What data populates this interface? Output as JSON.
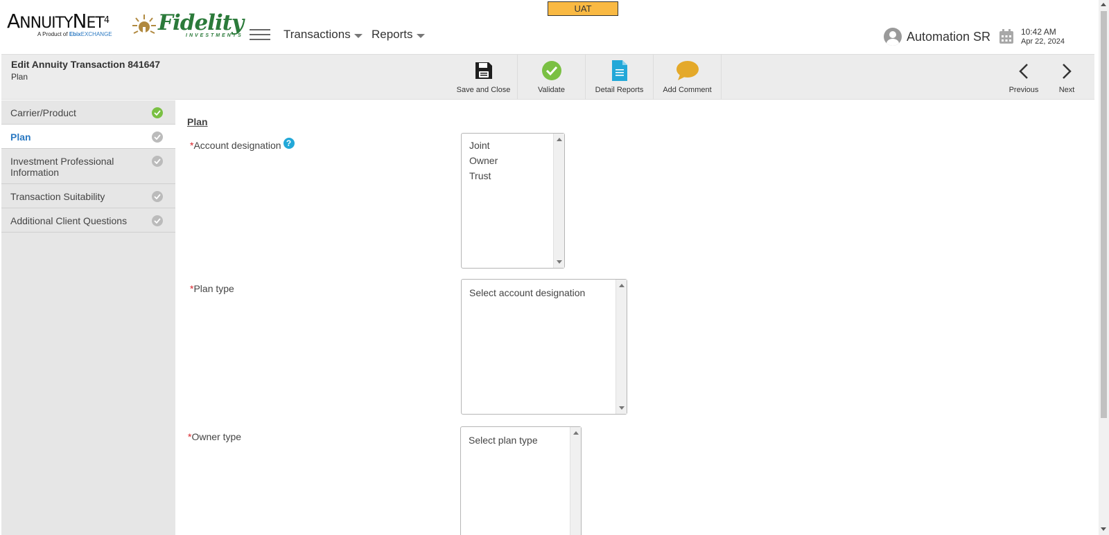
{
  "header": {
    "env_badge": "UAT",
    "logo_brand_big": "A",
    "logo_brand_rest": "NNUITY",
    "logo_brand_net": "N",
    "logo_brand_et": "ET",
    "logo_version": "4",
    "logo_sub_prefix": "A Product of",
    "logo_sub_ebix": "Ebix",
    "logo_sub_exchange": "EXCHANGE",
    "partner_name": "Fidelity",
    "partner_sub": "INVESTMENTS",
    "nav": [
      {
        "label": "Transactions"
      },
      {
        "label": "Reports"
      }
    ],
    "user_name": "Automation SR",
    "time": "10:42 AM",
    "date": "Apr 22, 2024"
  },
  "toolbar": {
    "title": "Edit Annuity Transaction 841647",
    "subtitle": "Plan",
    "buttons": [
      {
        "label": "Save and Close",
        "icon": "save-icon"
      },
      {
        "label": "Validate",
        "icon": "check-circle-icon",
        "color": "#7ac043"
      },
      {
        "label": "Detail Reports",
        "icon": "document-icon",
        "color": "#23a8d8"
      },
      {
        "label": "Add Comment",
        "icon": "comment-icon",
        "color": "#e4a92a"
      }
    ],
    "previous_label": "Previous",
    "next_label": "Next"
  },
  "sidebar": {
    "items": [
      {
        "label": "Carrier/Product",
        "status": "complete"
      },
      {
        "label": "Plan",
        "status": "active"
      },
      {
        "label": "Investment Professional Information",
        "status": "incomplete"
      },
      {
        "label": "Transaction Suitability",
        "status": "incomplete"
      },
      {
        "label": "Additional Client Questions",
        "status": "incomplete"
      }
    ]
  },
  "main": {
    "section_title": "Plan",
    "fields": {
      "account_designation": {
        "required_mark": "*",
        "label": "Account designation",
        "help": "?",
        "options": [
          "Joint",
          "Owner",
          "Trust"
        ]
      },
      "plan_type": {
        "required_mark": "*",
        "label": "Plan type",
        "options": [
          "Select account designation"
        ]
      },
      "owner_type": {
        "required_mark": "*",
        "label": "Owner type",
        "options": [
          "Select plan type"
        ]
      }
    }
  },
  "colors": {
    "env_badge": "#f9b943",
    "active_nav": "#2b79c2",
    "complete_check": "#7ac043",
    "required": "#d9242a",
    "help": "#23a8d8"
  }
}
